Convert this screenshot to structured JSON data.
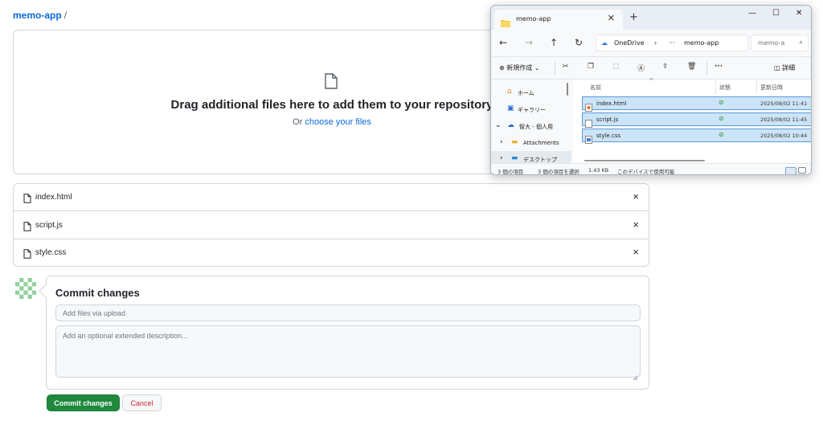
{
  "breadcrumb": {
    "repo": "memo-app",
    "separator": "/"
  },
  "dropzone": {
    "title": "Drag additional files here to add them to your repository",
    "or_text": "Or",
    "choose_link": "choose your files"
  },
  "files": [
    {
      "name": "index.html",
      "remove": "×"
    },
    {
      "name": "script.js",
      "remove": "×"
    },
    {
      "name": "style.css",
      "remove": "×"
    }
  ],
  "commit": {
    "title": "Commit changes",
    "summary_placeholder": "Add files via upload",
    "description_placeholder": "Add an optional extended description...",
    "commit_button": "Commit changes",
    "cancel_button": "Cancel"
  },
  "explorer": {
    "tab_title": "memo-app",
    "address": {
      "root": "OneDrive",
      "chevron": "›",
      "more": "···",
      "folder": "memo-app"
    },
    "search_placeholder": "memo-a",
    "toolbar": {
      "new": "新規作成",
      "details": "詳細"
    },
    "nav_pane": {
      "home": "ホーム",
      "gallery": "ギャラリー",
      "onedrive": "智大 - 個人用",
      "attachments": "Attachments",
      "desktop": "デスクトップ"
    },
    "columns": {
      "name": "名前",
      "status": "状態",
      "modified": "更新日時"
    },
    "rows": [
      {
        "name": "index.html",
        "modified": "2025/08/02 11:41",
        "icon": "html-file-icon"
      },
      {
        "name": "script.js",
        "modified": "2025/08/02 11:45",
        "icon": "js-file-icon"
      },
      {
        "name": "style.css",
        "modified": "2025/08/02 10:44",
        "icon": "css-file-icon"
      }
    ],
    "status_bar": {
      "count": "3 個の項目",
      "selected": "3 個の項目を選択",
      "size": "1.43 KB",
      "availability": "このデバイスで使用可能"
    }
  },
  "colors": {
    "link": "#0969da",
    "commit_green": "#1f883d",
    "cancel_red": "#cf222e",
    "selection": "#cce4f7"
  }
}
